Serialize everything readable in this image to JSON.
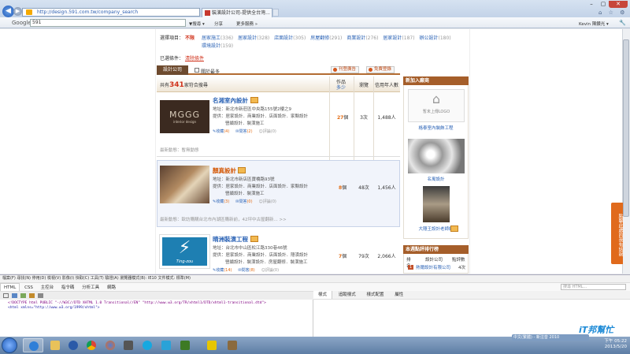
{
  "browser": {
    "url": "http://design.591.com.tw/company_search",
    "tab_title": "裝潢設計公司-提供全台灣...",
    "back_icon": "back-arrow-icon",
    "forward_icon": "forward-arrow-icon",
    "window_controls": {
      "minimize": "–",
      "maximize": "▢",
      "close": "✕"
    },
    "toolbar_icons": "⌂ ☆ ⚙"
  },
  "google_bar": {
    "logo": "Google",
    "query": "591",
    "search_label": "▼搜尋 ▾",
    "share_label": "分享",
    "more_label": "更多服務 »",
    "user_label": "Kevin 陳鑽光 ▾"
  },
  "filters": {
    "label": "選擇項目：",
    "selected": "不限",
    "options": [
      {
        "name": "居家施工",
        "count": "(336)"
      },
      {
        "name": "居家設計",
        "count": "(328)"
      },
      {
        "name": "店面設計",
        "count": "(305)"
      },
      {
        "name": "房屋翻修",
        "count": "(291)"
      },
      {
        "name": "商業設計",
        "count": "(276)"
      },
      {
        "name": "居家設計",
        "count": "(187)"
      },
      {
        "name": "辦公設計",
        "count": "(180)"
      }
    ],
    "option_line2": {
      "name": "環境設計",
      "count": "(159)"
    },
    "selected_conditions_label": "已選條件：",
    "clear_label": "清除條件"
  },
  "section": {
    "tab_label": "設計公司",
    "checkbox_label": "關於最多",
    "compare_button": "刊登廣告",
    "free_button": "免費登錄"
  },
  "list_header": {
    "total_prefix": "共有",
    "total_count": "341",
    "total_suffix": "家符合搜尋",
    "col_works": "作品",
    "col_works_sort": "多少",
    "col_views": "瀏覽",
    "col_sort": "信用年人數"
  },
  "companies": [
    {
      "name": "名湘室內設計",
      "logo_text": "MGGG",
      "logo_sub": "interior design",
      "address": "地址：新北市新莊區中央路155號2樓之9",
      "services1": "提供：居家設計．商業設計．店面設計．家縣設計",
      "services2": "營續設計．裝潢施工",
      "fav": "收藏",
      "fav_count": "(4)",
      "ask": "問答",
      "ask_count": "(2)",
      "review": "評論",
      "review_count": "(0)",
      "works": "27",
      "works_unit": "個",
      "views": "3次",
      "rating_count": "1,488人",
      "note": "最新動態：暫無動態"
    },
    {
      "name": "顏真設計",
      "address": "地址：新北市新店區寶橋路93號",
      "services1": "提供：居家設計．商業設計．店面設計．家縣設計",
      "services2": "營續設計．裝潢施工",
      "fav": "收藏",
      "fav_count": "(3)",
      "ask": "問答",
      "ask_count": "(0)",
      "review": "評論",
      "review_count": "(0)",
      "works": "8",
      "works_unit": "個",
      "views": "48次",
      "rating_count": "1,456人",
      "note": "最新動態：歐訪購購台北市內湖區購新前，42坪中古屋翻新... >>"
    },
    {
      "name": "晴洲裝潢工程",
      "logo_text": "Ting-zou",
      "address": "地址：台北市中山區松江路330巷46號",
      "services1": "提供：居家設計．商業設計．店面設計．隱潢設計",
      "services2": "營續設計．裝潢設計．房屋翻修．裝潢施工",
      "fav": "收藏",
      "fav_count": "(14)",
      "ask": "問答",
      "ask_count": "(8)",
      "review": "評論",
      "review_count": "(0)",
      "works": "7",
      "works_unit": "個",
      "views": "79次",
      "rating_count": "2,066人"
    }
  ],
  "sidebar": {
    "new_heading": "新加入廠商",
    "placeholder_text": "暫未上傳LOGO",
    "entries": [
      {
        "name": "格泰室內裝飾工程"
      },
      {
        "name": "名寓設計"
      },
      {
        "name": "大隱王設計老師網"
      }
    ],
    "rank_heading": "本週點評排行榜",
    "rank_cols": [
      "排名",
      "設計公司",
      "點評數"
    ],
    "rank_first": {
      "rank": "1",
      "company": "熱爾設計有限公司",
      "count": "4次"
    }
  },
  "feedback_label": "點擊此處的我有話說",
  "devtools": {
    "menu": "檔案(F)  尋找(N)  停用(D)  檢視(V)  影像(I)  快取(C)  工具(T)  驗證(A)  瀏覽器模式(B): IE10  文件模式: 標準(M)",
    "tabs": [
      "HTML",
      "CSS",
      "主控台",
      "指令碼",
      "分析工具",
      "網路"
    ],
    "search_placeholder": "搜尋 HTML...",
    "right_tabs": [
      "樣式",
      "追蹤樣式",
      "樣式配置",
      "屬性"
    ],
    "code_line1": "<!DOCTYPE html PUBLIC \"-//W3C//DTD XHTML 1.0 Transitional//EN\" \"http://www.w3.org/TR/xhtml1/DTD/xhtml1-transitional.dtd\">",
    "code_line2": "<html xmlns=\"http://www.w3.org/1999/xhtml\">"
  },
  "taskbar": {
    "tray_text": "中文(繁體) - 新注音 2010",
    "time": "下午 05:22",
    "date": "2013/5/20",
    "watermark": "iT邦幫忙"
  }
}
